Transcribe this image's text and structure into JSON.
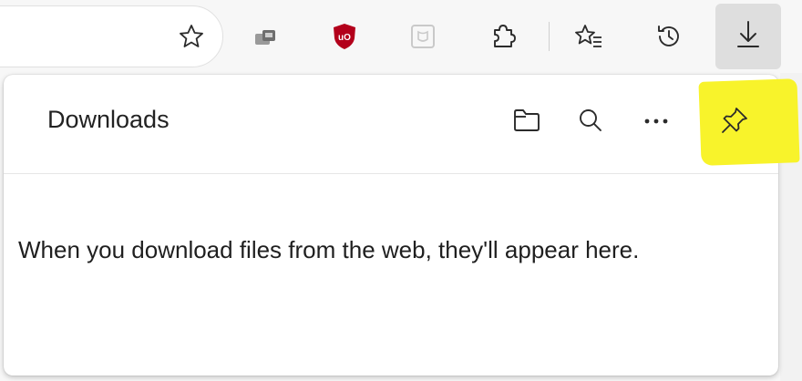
{
  "toolbar": {
    "icons": [
      "favorite-star-icon",
      "extension-icon",
      "ublock-origin-icon",
      "extension-square-icon",
      "extensions-puzzle-icon",
      "favorites-icon",
      "history-icon",
      "downloads-icon"
    ],
    "ublock_label": "uO"
  },
  "panel": {
    "title": "Downloads",
    "actions": [
      "open-folder-icon",
      "search-icon",
      "more-options-icon",
      "pin-icon"
    ],
    "more_label": "···",
    "empty_message": "When you download files from the web, they'll appear here."
  },
  "colors": {
    "highlight": "#f8f32b",
    "ublock_red": "#b3001b",
    "toolbar_bg": "#f7f7f7",
    "active_button_bg": "#dedede"
  }
}
